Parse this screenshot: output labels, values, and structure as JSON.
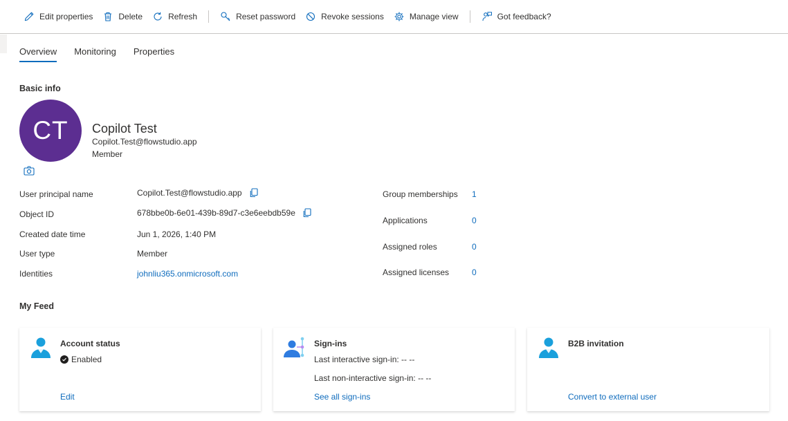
{
  "toolbar": {
    "edit_properties": "Edit properties",
    "delete": "Delete",
    "refresh": "Refresh",
    "reset_password": "Reset password",
    "revoke_sessions": "Revoke sessions",
    "manage_view": "Manage view",
    "got_feedback": "Got feedback?"
  },
  "tabs": {
    "overview": "Overview",
    "monitoring": "Monitoring",
    "properties": "Properties"
  },
  "basic_info": {
    "title": "Basic info",
    "initials": "CT",
    "avatar_color": "#5c2e91",
    "name": "Copilot Test",
    "email": "Copilot.Test@flowstudio.app",
    "user_type": "Member"
  },
  "properties": {
    "upn_label": "User principal name",
    "upn_value": "Copilot.Test@flowstudio.app",
    "object_id_label": "Object ID",
    "object_id_value": "678bbe0b-6e01-439b-89d7-c3e6eebdb59e",
    "created_label": "Created date time",
    "created_value": "Jun 1, 2026, 1:40 PM",
    "user_type_label": "User type",
    "user_type_value": "Member",
    "identities_label": "Identities",
    "identities_value": "johnliu365.onmicrosoft.com"
  },
  "stats": {
    "group_label": "Group memberships",
    "group_value": "1",
    "apps_label": "Applications",
    "apps_value": "0",
    "roles_label": "Assigned roles",
    "roles_value": "0",
    "licenses_label": "Assigned licenses",
    "licenses_value": "0"
  },
  "feed": {
    "title": "My Feed",
    "account": {
      "title": "Account status",
      "status": "Enabled",
      "link": "Edit"
    },
    "signins": {
      "title": "Sign-ins",
      "interactive": "Last interactive sign-in: -- --",
      "non_interactive": "Last non-interactive sign-in: -- --",
      "link": "See all sign-ins"
    },
    "b2b": {
      "title": "B2B invitation",
      "link": "Convert to external user"
    }
  },
  "colors": {
    "accent": "#0f6cbd",
    "person_icon": "#1aa0dc"
  }
}
